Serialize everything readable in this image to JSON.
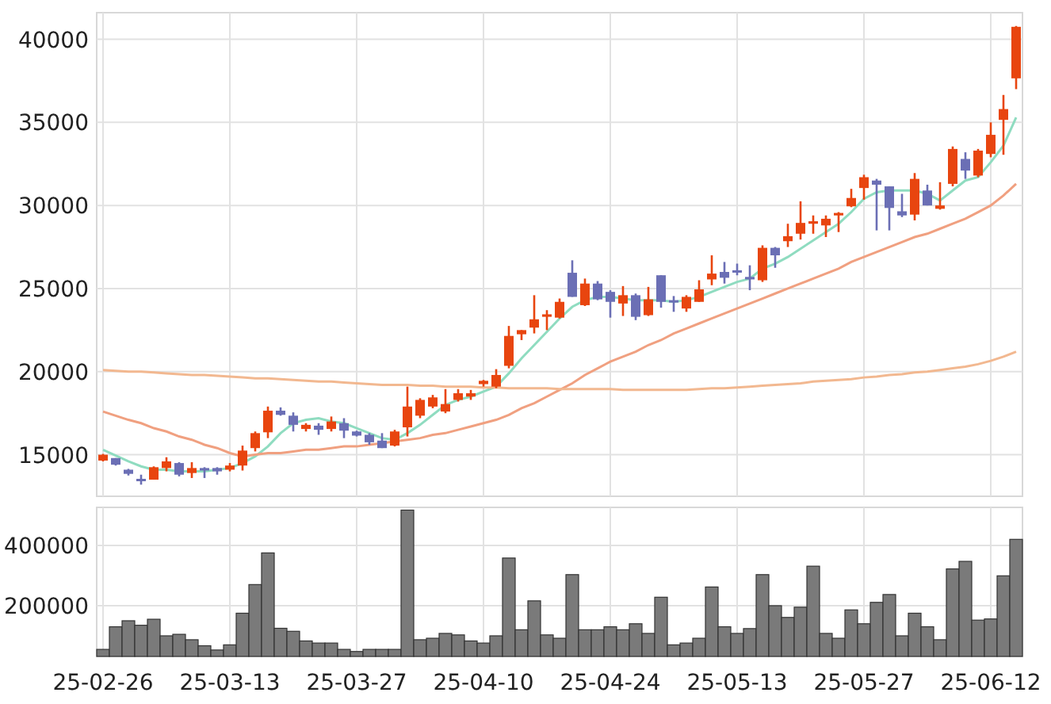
{
  "price_chart": {
    "chart_data": {
      "type": "candlestick",
      "grid": true,
      "ylim": [
        12500,
        41600
      ],
      "yticks": [
        15000,
        20000,
        25000,
        30000,
        35000,
        40000
      ],
      "categories": [
        null,
        null,
        null,
        null,
        null,
        null,
        null,
        null,
        null,
        null,
        null,
        null,
        null,
        null,
        null,
        null,
        null,
        null,
        null,
        null,
        null,
        null,
        null,
        null,
        null,
        null,
        null,
        null,
        null,
        null,
        null,
        null,
        null,
        null,
        null,
        null,
        null,
        null,
        null,
        null,
        null,
        null,
        null,
        null,
        null,
        null,
        null,
        null,
        null,
        null,
        null,
        null,
        null,
        null,
        null,
        null,
        null,
        null,
        null,
        null,
        null,
        null,
        null,
        null,
        null,
        null,
        null,
        null,
        null,
        null,
        null,
        null,
        null
      ],
      "ohlc": [
        [
          14650,
          15050,
          14600,
          15000
        ],
        [
          14800,
          14800,
          14350,
          14400
        ],
        [
          14100,
          14150,
          13750,
          13850
        ],
        [
          13550,
          13800,
          13200,
          13500
        ],
        [
          13500,
          14300,
          13500,
          14250
        ],
        [
          14200,
          14850,
          14000,
          14600
        ],
        [
          14500,
          14550,
          13700,
          13800
        ],
        [
          13900,
          14550,
          13600,
          14200
        ],
        [
          14200,
          14250,
          13600,
          14050
        ],
        [
          14200,
          14250,
          13800,
          14000
        ],
        [
          14100,
          14500,
          14000,
          14350
        ],
        [
          14350,
          15550,
          14050,
          15250
        ],
        [
          15400,
          16400,
          15200,
          16300
        ],
        [
          16350,
          17900,
          16000,
          17650
        ],
        [
          17650,
          17850,
          17350,
          17400
        ],
        [
          17350,
          17550,
          16400,
          16800
        ],
        [
          16550,
          16900,
          16400,
          16800
        ],
        [
          16750,
          16900,
          16200,
          16500
        ],
        [
          16550,
          17300,
          16400,
          17000
        ],
        [
          16900,
          17200,
          16000,
          16450
        ],
        [
          16400,
          16450,
          16100,
          16150
        ],
        [
          16200,
          16300,
          15600,
          15750
        ],
        [
          15850,
          16300,
          15400,
          15400
        ],
        [
          15550,
          16500,
          15500,
          16400
        ],
        [
          16650,
          19100,
          16100,
          17900
        ],
        [
          17350,
          18400,
          17200,
          18300
        ],
        [
          17900,
          18600,
          17800,
          18450
        ],
        [
          17600,
          18950,
          17500,
          18050
        ],
        [
          18300,
          18950,
          18200,
          18700
        ],
        [
          18500,
          18900,
          18300,
          18700
        ],
        [
          19250,
          19500,
          19100,
          19450
        ],
        [
          19100,
          20150,
          19000,
          19800
        ],
        [
          20350,
          22750,
          20200,
          22150
        ],
        [
          22250,
          22500,
          21900,
          22500
        ],
        [
          22650,
          24600,
          22300,
          23150
        ],
        [
          23300,
          23700,
          22500,
          23450
        ],
        [
          23250,
          24400,
          23200,
          24200
        ],
        [
          25950,
          26700,
          24500,
          24500
        ],
        [
          24000,
          25600,
          23950,
          25300
        ],
        [
          25300,
          25450,
          24300,
          24350
        ],
        [
          24800,
          24900,
          23250,
          24200
        ],
        [
          24100,
          25150,
          23350,
          24600
        ],
        [
          24600,
          24700,
          23100,
          23300
        ],
        [
          23400,
          25100,
          23350,
          24350
        ],
        [
          25800,
          25800,
          23850,
          24200
        ],
        [
          24300,
          24550,
          23600,
          24250
        ],
        [
          23800,
          24600,
          23600,
          24500
        ],
        [
          24200,
          25500,
          24200,
          24950
        ],
        [
          25550,
          27000,
          25200,
          25900
        ],
        [
          26000,
          26600,
          25300,
          25650
        ],
        [
          26100,
          26500,
          25800,
          26050
        ],
        [
          25700,
          26400,
          24900,
          25550
        ],
        [
          25500,
          27600,
          25400,
          27450
        ],
        [
          27450,
          27500,
          26250,
          27000
        ],
        [
          27850,
          28900,
          27500,
          28150
        ],
        [
          28300,
          30250,
          27950,
          28950
        ],
        [
          28900,
          29400,
          28300,
          29050
        ],
        [
          28800,
          29400,
          28100,
          29200
        ],
        [
          29400,
          29600,
          28400,
          29550
        ],
        [
          29950,
          31000,
          29900,
          30450
        ],
        [
          31050,
          31850,
          30350,
          31700
        ],
        [
          31500,
          31600,
          28500,
          31250
        ],
        [
          31150,
          31150,
          28500,
          29850
        ],
        [
          29650,
          30700,
          29300,
          29400
        ],
        [
          29450,
          31950,
          29100,
          31600
        ],
        [
          30900,
          31250,
          30000,
          30000
        ],
        [
          29800,
          31400,
          29750,
          30000
        ],
        [
          31300,
          33550,
          31150,
          33400
        ],
        [
          32800,
          33200,
          31600,
          32100
        ],
        [
          31800,
          33400,
          31700,
          33300
        ],
        [
          33100,
          35000,
          32900,
          34250
        ],
        [
          35150,
          36650,
          33050,
          35800
        ],
        [
          37650,
          40800,
          37000,
          40750
        ]
      ],
      "series": [
        {
          "type": "line",
          "color": "#8fdcc0",
          "values": [
            15300,
            14950,
            14600,
            14300,
            14100,
            14100,
            14000,
            14000,
            14000,
            14100,
            14200,
            14500,
            14900,
            15500,
            16300,
            16900,
            17100,
            17200,
            17000,
            16900,
            16600,
            16300,
            16000,
            15900,
            16300,
            16800,
            17400,
            18000,
            18300,
            18500,
            18800,
            19100,
            19900,
            20800,
            21600,
            22400,
            23200,
            23900,
            24300,
            24500,
            24500,
            24400,
            24300,
            24300,
            24300,
            24200,
            24300,
            24500,
            24800,
            25100,
            25400,
            25600,
            26200,
            26500,
            26900,
            27400,
            27900,
            28400,
            28900,
            29600,
            30400,
            30800,
            30900,
            30900,
            30900,
            30700,
            30300,
            30900,
            31500,
            31700,
            32600,
            33600,
            35300
          ]
        },
        {
          "type": "line",
          "color": "#f0a080",
          "values": [
            17600,
            17350,
            17100,
            16900,
            16600,
            16400,
            16100,
            15900,
            15600,
            15400,
            15100,
            14900,
            15000,
            15100,
            15100,
            15200,
            15300,
            15300,
            15400,
            15500,
            15500,
            15600,
            15700,
            15800,
            15900,
            16000,
            16200,
            16300,
            16500,
            16700,
            16900,
            17100,
            17400,
            17800,
            18100,
            18500,
            18900,
            19300,
            19800,
            20200,
            20600,
            20900,
            21200,
            21600,
            21900,
            22300,
            22600,
            22900,
            23200,
            23500,
            23800,
            24100,
            24400,
            24700,
            25000,
            25300,
            25600,
            25900,
            26200,
            26600,
            26900,
            27200,
            27500,
            27800,
            28100,
            28300,
            28600,
            28900,
            29200,
            29600,
            30000,
            30600,
            31300
          ]
        },
        {
          "type": "line",
          "color": "#f2b890",
          "values": [
            20100,
            20050,
            20000,
            20000,
            19950,
            19900,
            19850,
            19800,
            19800,
            19750,
            19700,
            19650,
            19600,
            19600,
            19550,
            19500,
            19450,
            19400,
            19400,
            19350,
            19300,
            19250,
            19200,
            19200,
            19200,
            19150,
            19150,
            19100,
            19100,
            19100,
            19050,
            19050,
            19000,
            19000,
            19000,
            19000,
            18950,
            18950,
            18950,
            18950,
            18950,
            18900,
            18900,
            18900,
            18900,
            18900,
            18900,
            18950,
            19000,
            19000,
            19050,
            19100,
            19150,
            19200,
            19250,
            19300,
            19400,
            19450,
            19500,
            19550,
            19650,
            19700,
            19800,
            19850,
            19950,
            20000,
            20100,
            20200,
            20300,
            20450,
            20650,
            20900,
            21200
          ]
        }
      ]
    }
  },
  "volume_chart": {
    "chart_data": {
      "type": "bar",
      "grid": true,
      "ylim": [
        31600,
        526000
      ],
      "yticks": [
        200000,
        400000
      ],
      "categories": [
        "25-02-26",
        null,
        null,
        null,
        null,
        null,
        null,
        null,
        null,
        null,
        "25-03-13",
        null,
        null,
        null,
        null,
        null,
        null,
        null,
        null,
        null,
        "25-03-27",
        null,
        null,
        null,
        null,
        null,
        null,
        null,
        null,
        null,
        "25-04-10",
        null,
        null,
        null,
        null,
        null,
        null,
        null,
        null,
        null,
        "25-04-24",
        null,
        null,
        null,
        null,
        null,
        null,
        null,
        null,
        null,
        "25-05-13",
        null,
        null,
        null,
        null,
        null,
        null,
        null,
        null,
        null,
        "25-05-27",
        null,
        null,
        null,
        null,
        null,
        null,
        null,
        null,
        null,
        "25-06-12",
        null,
        null
      ],
      "series": [
        {
          "color": "#7a7a7a",
          "values": [
            55000,
            130000,
            150000,
            135000,
            155000,
            100000,
            105000,
            87000,
            67000,
            53000,
            70000,
            175000,
            270000,
            375000,
            125000,
            115000,
            83000,
            76000,
            76000,
            55000,
            48000,
            55000,
            55000,
            55000,
            517000,
            87000,
            92000,
            108000,
            103000,
            83000,
            76000,
            100000,
            358000,
            120000,
            216000,
            103000,
            92000,
            303000,
            120000,
            120000,
            130000,
            120000,
            140000,
            108000,
            228000,
            70000,
            76000,
            92000,
            262000,
            130000,
            108000,
            124000,
            303000,
            200000,
            161000,
            195000,
            331000,
            108000,
            92000,
            186000,
            140000,
            211000,
            237000,
            100000,
            175000,
            130000,
            87000,
            322000,
            347000,
            152000,
            156000,
            299000,
            420000
          ]
        }
      ]
    }
  }
}
